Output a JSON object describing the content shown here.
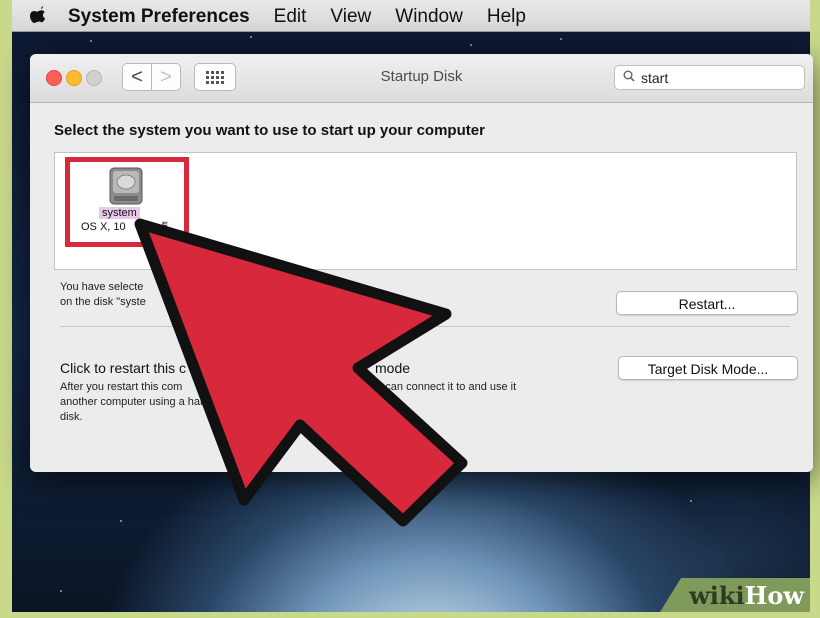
{
  "menubar": {
    "apple_icon": "apple-icon",
    "items": [
      "System Preferences",
      "Edit",
      "View",
      "Window",
      "Help"
    ]
  },
  "window": {
    "title": "Startup Disk",
    "search": {
      "value": "start",
      "icon": "magnifier-icon"
    },
    "nav": {
      "back": "<",
      "forward": ">",
      "grid_icon": "grid-icon"
    }
  },
  "content": {
    "prompt": "Select the system you want to use to start up your computer",
    "disk": {
      "name": "system",
      "os_prefix": "OS X, 10",
      "os_suffix": "5"
    },
    "selection_line1": "You have selecte",
    "selection_line2": "on the disk \"syste",
    "restart_button": "Restart...",
    "tdm_heading_head": "Click to restart this c",
    "tdm_heading_tail": "mode",
    "tdm_desc_head": "After you restart this com another computer using a hard disk.",
    "tdm_desc_tail": "ou can connect it to and use it as a",
    "tdm_button": "Target Disk Mode..."
  },
  "overlay": {
    "arrow_color": "#d8283c"
  },
  "watermark": {
    "wiki": "wiki",
    "how": "How"
  }
}
